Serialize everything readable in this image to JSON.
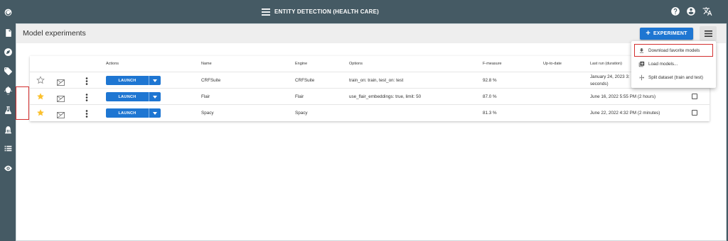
{
  "app": {
    "title": "ENTITY DETECTION (HEALTH CARE)",
    "accent_color": "#1e76d2",
    "sidebar_color": "#455a64",
    "highlight_color": "#d32f2f"
  },
  "sidebar": {
    "icons": [
      "eye-logo-icon",
      "document-icon",
      "compass-icon",
      "tag-icon",
      "lightbulb-icon",
      "flask-icon",
      "bank-icon",
      "list-icon",
      "eye-settings-icon"
    ]
  },
  "topbar": {
    "icons": [
      "help-icon",
      "account-icon",
      "translate-icon"
    ]
  },
  "header": {
    "page_title": "Model experiments",
    "experiment_button": "EXPERIMENT"
  },
  "table": {
    "columns": {
      "actions": "Actions",
      "name": "Name",
      "engine": "Engine",
      "options": "Options",
      "fmeasure": "F-measure",
      "uptodate": "Up-to-date",
      "lastrun": "Last run (duration)"
    },
    "launch_label": "LAUNCH",
    "rows": [
      {
        "favorite": false,
        "name": "CRFSuite",
        "engine": "CRFSuite",
        "options": "train_on: train, test_on: test",
        "fmeasure": "92.8 %",
        "lastrun_line1": "January 24, 2023 3:",
        "lastrun_line2": "seconds)"
      },
      {
        "favorite": true,
        "name": "Flair",
        "engine": "Flair",
        "options": "use_flair_embeddings: true, limit: 50",
        "fmeasure": "87.0 %",
        "lastrun": "June 16, 2022 5:55 PM (2 hours)"
      },
      {
        "favorite": true,
        "name": "Spacy",
        "engine": "Spacy",
        "options": "",
        "fmeasure": "81.3 %",
        "lastrun": "June 22, 2022 4:32 PM (2 minutes)"
      }
    ]
  },
  "menu": {
    "items": [
      {
        "label": "Download favorite models",
        "icon": "download-icon"
      },
      {
        "label": "Load models...",
        "icon": "add-box-icon"
      },
      {
        "label": "Split dataset (train and test)",
        "icon": "split-icon"
      }
    ]
  }
}
